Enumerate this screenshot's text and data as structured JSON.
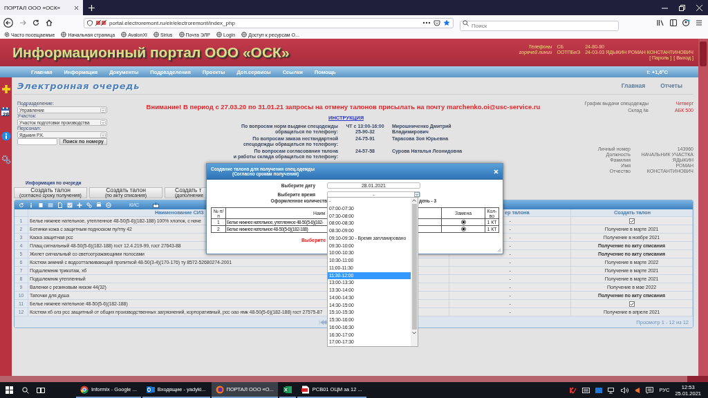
{
  "browser": {
    "tab_title": "ПОРТАЛ ООО «ОСК»",
    "url": "portal.electroremont.ru/elr/electroremont/index_php",
    "search_placeholder": "Поиск",
    "bookmarks": [
      {
        "kind": "gear",
        "label": "Часто посещаемые"
      },
      {
        "kind": "globe",
        "label": "Начальная страница"
      },
      {
        "kind": "globe",
        "label": "AvalonXI"
      },
      {
        "kind": "globe",
        "label": "Sirius"
      },
      {
        "kind": "globe",
        "label": "Почта ЭЛР"
      },
      {
        "kind": "globe",
        "label": "Login"
      },
      {
        "kind": "globe",
        "label": "Доступ к ресурсам О..."
      }
    ]
  },
  "header": {
    "title": "Информационный портал ООО «ОСК»",
    "hotline_label": [
      "Телефоны",
      "горячей линии"
    ],
    "hotlines": [
      {
        "dept": "СБ",
        "phone": "24-80-80"
      },
      {
        "dept": "ООТПБиЭ",
        "phone": "24-03-03 ЯДЫКИН РОМАН КОНСТАНТИНОВИЧ"
      }
    ],
    "account_links": [
      "[ Пароль ]",
      "[ Выход ]"
    ]
  },
  "nav": {
    "items": [
      "Главная",
      "Информация",
      "Документы",
      "Подразделения",
      "Проекты",
      "Доп.сервисы",
      "Ссылки",
      "Помощь"
    ],
    "temperature": "t: +1,6°C"
  },
  "sidebar": {
    "calendar_day": "28"
  },
  "page": {
    "title": "Электронная очередь",
    "links": [
      "Главная",
      "Отчеты"
    ]
  },
  "filters": [
    {
      "label": "Подразделение:",
      "value": "Управление"
    },
    {
      "label": "Участок:",
      "value": "Участок подготовки производства"
    },
    {
      "label": "Персонал:",
      "value": "Ядыкин Р.К."
    }
  ],
  "search_button": "Поиск по номеру",
  "notice": "Внимание! В период с 27.03.20 по 31.01.21 запросы на отмену талонов присылать на почту marchenko.oi@usc-service.ru",
  "instruction_link": "ИНСТРУКЦИЯ",
  "contacts": [
    {
      "question": [
        "По вопросам норм выдачи спецодежды",
        "обращаться по телефону:"
      ],
      "phone": [
        "ЧТ с 13:00-16:00",
        "25-90-32"
      ],
      "person": [
        "Мирошниченко Дмитрий",
        "Владимирович"
      ]
    },
    {
      "question": [
        "По вопросам заказа нестандартной",
        "спецодежды обращаться по телефону:"
      ],
      "phone": [
        "24-75-91"
      ],
      "person": [
        "Тарасова Зоя Юрьевна"
      ]
    },
    {
      "question": [
        "По вопросам согласования талона",
        "и работы склада обращаться по телефону:"
      ],
      "phone": [
        "24-57-58"
      ],
      "person": [
        "Сурова Наталья Леонидовна"
      ]
    }
  ],
  "schedule": [
    {
      "label": "График выдачи спецодежды",
      "value": "Четверг"
    },
    {
      "label": "Склад №",
      "value": "АБК 500"
    }
  ],
  "employee": [
    {
      "label": "Личный номер",
      "value": "143960"
    },
    {
      "label": "Должность",
      "value": "НАЧАЛЬНИК УЧАСТКА"
    },
    {
      "label": "Фамилия",
      "value": "ЯДЫКИН"
    },
    {
      "label": "Имя",
      "value": "РОМАН"
    },
    {
      "label": "Отчество",
      "value": "КОНСТАНТИНОВИЧ"
    }
  ],
  "queue_info": "Информация по очереди",
  "create_buttons": [
    {
      "title": "Создать талон",
      "subtitle": "(согласно сроку получения)"
    },
    {
      "title": "Создать талон",
      "subtitle": "(по акту списания)"
    },
    {
      "title": "Создать т",
      "subtitle": "(дополнение"
    }
  ],
  "grid": {
    "toolbar_label": "КИС",
    "columns": [
      "Наименование СИЗ",
      "ер талона",
      "Создать талон"
    ],
    "rows": [
      {
        "num": "1",
        "name": "Белье нижнее нательное, утепленное  48-50(5-6)(182-188)  100% хлопок, с наче",
        "ticket": "-",
        "create": {
          "kind": "checkbox",
          "checked": true
        }
      },
      {
        "num": "2",
        "name": "Ботинки кожа  с защитным подноском  пу/тпу  42",
        "ticket": "-",
        "create": {
          "kind": "text",
          "text": "Получение в марте 2021",
          "bold": false
        }
      },
      {
        "num": "3",
        "name": "Каска защитная рсс",
        "ticket": "-",
        "create": {
          "kind": "text",
          "text": "Получение в ноябре 2021",
          "bold": false
        }
      },
      {
        "num": "4",
        "name": "Плащ сигнальный  48-50(5-6)(182-188)  гост 12.4.219-99, гост 27643-88",
        "ticket": "-",
        "create": {
          "kind": "text",
          "text": "Получение по акту списания",
          "bold": true
        }
      },
      {
        "num": "5",
        "name": "Жилет сигнальный со светоотражающими полосами",
        "ticket": "-",
        "create": {
          "kind": "text",
          "text": "Получение по акту списания",
          "bold": true
        }
      },
      {
        "num": "6",
        "name": "Костюм зимний  с водоотталкивающей пропиткой  48-50(3-4)(170-176)  ту 8572-52680274-2001",
        "ticket": "-",
        "create": {
          "kind": "text",
          "text": "Получение в марте 2022",
          "bold": false
        }
      },
      {
        "num": "7",
        "name": "Подшлемник трикотаж, хб",
        "ticket": "-",
        "create": {
          "kind": "text",
          "text": "Получение в марте 2021",
          "bold": false
        }
      },
      {
        "num": "8",
        "name": "Подшлемник утепленный",
        "ticket": "-",
        "create": {
          "kind": "text",
          "text": "Получение в марте 2021",
          "bold": false
        }
      },
      {
        "num": "9",
        "name": "Валенки с резиновым низом  44(32)",
        "ticket": "-",
        "create": {
          "kind": "text",
          "text": "Получение в мае 2022",
          "bold": false
        }
      },
      {
        "num": "10",
        "name": "Тапочки для душа",
        "ticket": "-",
        "create": {
          "kind": "text",
          "text": "Получение по акту списания",
          "bold": true
        }
      },
      {
        "num": "11",
        "name": "Белье нижнее нательное  48-50(5-6)(182-188)",
        "ticket": "-",
        "create": {
          "kind": "checkbox",
          "checked": true
        }
      },
      {
        "num": "12",
        "name": "Костюм хб олз рсс защитный от общих производственных загрязнений, корпоративный, рсс оао нмк  48-50(5-6)(182-188)  гост 27575-87",
        "ticket": "-",
        "create": {
          "kind": "text",
          "text": "Получение в апреле 2021",
          "bold": false
        }
      }
    ],
    "footer": "Просмотр 1 - 12 из 12"
  },
  "dialog": {
    "title": [
      "Создание талона для получения спец.одежды",
      "(Согласно срокам получения)"
    ],
    "date_label": "Выберите дату",
    "date_value": "28.01.2021",
    "time_label": "Выберите время",
    "time_value": "-",
    "count_text": "Оформленное количеств",
    "count_tail": "день - 3",
    "columns": [
      "№ п/п",
      "Наим",
      "Замена",
      "Кол-во"
    ],
    "items": [
      {
        "num": "1",
        "name": "Белье нижнее нательное, утепленное 48-50(5-6)(182-",
        "replace_selected": true,
        "qty": "1 КТ"
      },
      {
        "num": "2",
        "name": "Белье нижнее нательное 48-50(5-6)(182-188)",
        "replace_selected": true,
        "qty": "1 КТ"
      }
    ],
    "warning": "Выберите",
    "time_options": [
      {
        "label": "-",
        "selected": false
      },
      {
        "label": "07:00-07:30",
        "selected": false
      },
      {
        "label": "07:30-08:00",
        "selected": false
      },
      {
        "label": "08:00-08:30",
        "selected": false
      },
      {
        "label": "08:30-09:00",
        "selected": false
      },
      {
        "label": "09:10-09:30 - Время запланировано",
        "selected": false
      },
      {
        "label": "09:30-10:00",
        "selected": false
      },
      {
        "label": "10:00-10:30",
        "selected": false
      },
      {
        "label": "10:30-11:00",
        "selected": false
      },
      {
        "label": "11:00-11:30",
        "selected": false
      },
      {
        "label": "11:30-12:00",
        "selected": true
      },
      {
        "label": "13:00-13:30",
        "selected": false
      },
      {
        "label": "13:30-14:00",
        "selected": false
      },
      {
        "label": "14:00-14:30",
        "selected": false
      },
      {
        "label": "14:30-15:00",
        "selected": false
      },
      {
        "label": "15:10-15:30",
        "selected": false
      },
      {
        "label": "15:30-16:00",
        "selected": false
      },
      {
        "label": "16:00-16:30",
        "selected": false
      },
      {
        "label": "16:30-17:00",
        "selected": false
      },
      {
        "label": "17:00-17:30",
        "selected": false
      }
    ]
  },
  "taskbar": {
    "items": [
      {
        "kind": "chrome",
        "label": "Informix - Google ...",
        "active": false
      },
      {
        "kind": "outlook",
        "label": "Входящие - yadyki...",
        "active": false
      },
      {
        "kind": "firefox",
        "label": "ПОРТАЛ ООО «О...",
        "active": true
      },
      {
        "kind": "excel",
        "active": false
      },
      {
        "kind": "pdf",
        "label": "РСВ01 ОЦМ за 12 ...",
        "active": false
      }
    ],
    "language": "РУС",
    "time": "12:53",
    "date": "25.01.2021"
  }
}
